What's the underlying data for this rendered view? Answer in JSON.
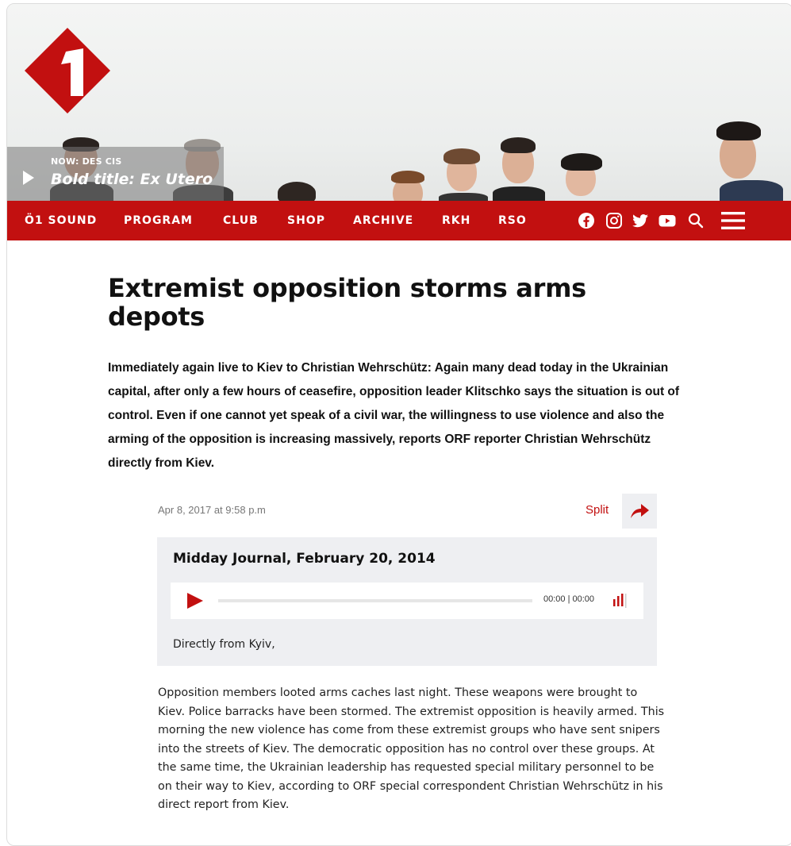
{
  "colors": {
    "brand_red": "#c21010",
    "audio_bg": "#eeeff2"
  },
  "now_playing": {
    "label": "NOW: DES CIS",
    "title": "Bold title: Ex Utero"
  },
  "nav": {
    "items": [
      "Ö1 SOUND",
      "PROGRAM",
      "CLUB",
      "SHOP",
      "ARCHIVE",
      "RKH",
      "RSO"
    ],
    "icons": [
      "facebook-icon",
      "instagram-icon",
      "twitter-icon",
      "youtube-icon",
      "search-icon",
      "menu-icon"
    ]
  },
  "article": {
    "headline": "Extremist opposition storms arms depots",
    "lede": "Immediately again live to Kiev to Christian Wehrschütz: Again many dead today in the Ukrainian capital, after only a few hours of ceasefire, opposition leader Klitschko says the situation is out of control. Even if one cannot yet speak of a civil war, the willingness to use violence and also the arming of the opposition is increasing massively, reports ORF reporter Christian Wehrschütz directly from Kiev.",
    "date": "Apr 8, 2017 at 9:58 p.m",
    "split_label": "Split",
    "audio": {
      "title": "Midday Journal, February 20, 2014",
      "time": "00:00 | 00:00",
      "progress": 0,
      "caption": "Directly from Kyiv,"
    },
    "body": "Opposition members looted arms caches last night. These weapons were brought to Kiev. Police barracks have been stormed. The extremist opposition is heavily armed. This morning the new violence has come from these extremist groups who have sent snipers into the streets of Kiev. The democratic opposition has no control over these groups. At the same time, the Ukrainian leadership has requested special military personnel to be on their way to Kiev, according to ORF special correspondent Christian Wehrschütz in his direct report from Kiev."
  }
}
